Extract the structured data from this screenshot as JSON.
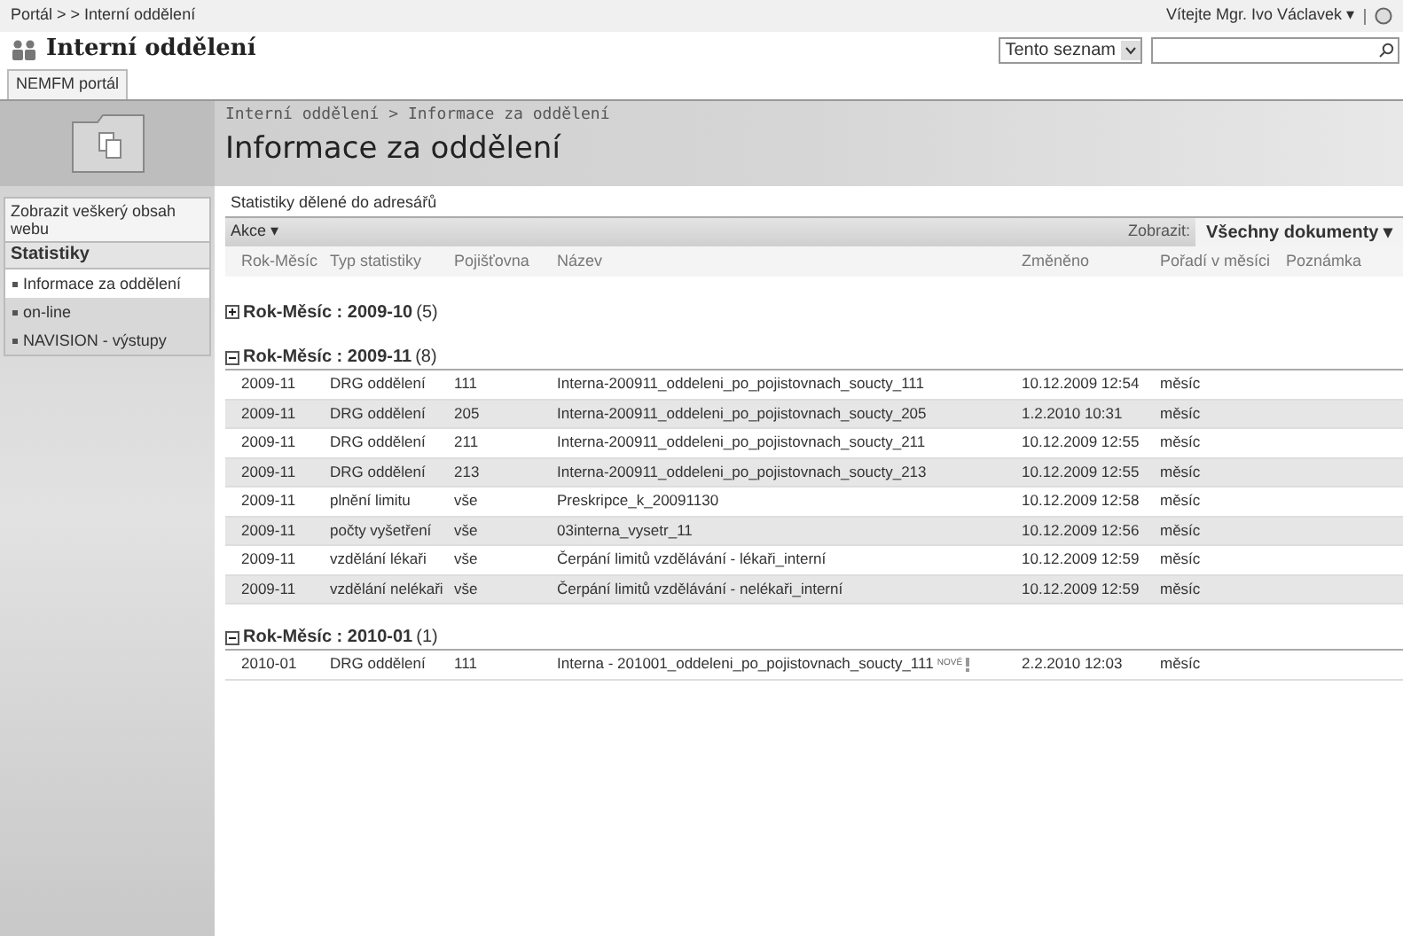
{
  "breadcrumb_top": "Portál > > Interní oddělení",
  "welcome": "Vítejte Mgr. Ivo Václavek ▾",
  "site_title": "Interní oddělení",
  "search": {
    "scope": "Tento seznam"
  },
  "top_tabs": [
    {
      "label": "NEMFM portál",
      "selected": true
    }
  ],
  "page_breadcrumb": "Interní oddělení > Informace za oddělení",
  "page_title": "Informace za oddělení",
  "sidebar": {
    "view_all": "Zobrazit veškerý obsah webu",
    "heading": "Statistiky",
    "items": [
      {
        "label": "Informace za oddělení",
        "selected": true
      },
      {
        "label": "on-line",
        "selected": false
      },
      {
        "label": "NAVISION - výstupy",
        "selected": false
      }
    ]
  },
  "list_description": "Statistiky dělené do adresářů",
  "toolbar": {
    "actions": "Akce ▾",
    "view_label": "Zobrazit:",
    "view": "Všechny dokumenty ▾"
  },
  "table": {
    "columns": [
      "Rok-Měsíc",
      "Typ statistiky",
      "Pojišťovna",
      "Název",
      "Změněno",
      "Pořadí v měsíci",
      "Poznámka"
    ],
    "groups": [
      {
        "label": "Rok-Měsíc :",
        "value": "2009-10",
        "count": "(5)",
        "expanded": false
      },
      {
        "label": "Rok-Měsíc :",
        "value": "2009-11",
        "count": "(8)",
        "expanded": true,
        "rows": [
          {
            "cells": [
              "2009-11",
              "DRG oddělení",
              "111",
              "Interna-200911_oddeleni_po_pojistovnach_soucty_111",
              "10.12.2009 12:54",
              "měsíc"
            ]
          },
          {
            "cells": [
              "2009-11",
              "DRG oddělení",
              "205",
              "Interna-200911_oddeleni_po_pojistovnach_soucty_205",
              "1.2.2010 10:31",
              "měsíc"
            ]
          },
          {
            "cells": [
              "2009-11",
              "DRG oddělení",
              "211",
              "Interna-200911_oddeleni_po_pojistovnach_soucty_211",
              "10.12.2009 12:55",
              "měsíc"
            ]
          },
          {
            "cells": [
              "2009-11",
              "DRG oddělení",
              "213",
              "Interna-200911_oddeleni_po_pojistovnach_soucty_213",
              "10.12.2009 12:55",
              "měsíc"
            ]
          },
          {
            "cells": [
              "2009-11",
              "plnění limitu",
              "vše",
              "Preskripce_k_20091130",
              "10.12.2009 12:58",
              "měsíc"
            ]
          },
          {
            "cells": [
              "2009-11",
              "počty vyšetření",
              "vše",
              "03interna_vysetr_11",
              "10.12.2009 12:56",
              "měsíc"
            ]
          },
          {
            "cells": [
              "2009-11",
              "vzdělání lékaři",
              "vše",
              "Čerpání limitů vzdělávání - lékaři_interní",
              "10.12.2009 12:59",
              "měsíc"
            ]
          },
          {
            "cells": [
              "2009-11",
              "vzdělání nelékaři",
              "vše",
              "Čerpání limitů vzdělávání - nelékaři_interní",
              "10.12.2009 12:59",
              "měsíc"
            ]
          }
        ]
      },
      {
        "label": "Rok-Měsíc :",
        "value": "2010-01",
        "count": "(1)",
        "expanded": true,
        "rows": [
          {
            "cells": [
              "2010-01",
              "DRG oddělení",
              "111",
              "Interna - 201001_oddeleni_po_pojistovnach_soucty_111",
              "2.2.2010 12:03",
              "měsíc"
            ],
            "badge": "NOVÉ"
          }
        ]
      }
    ]
  }
}
